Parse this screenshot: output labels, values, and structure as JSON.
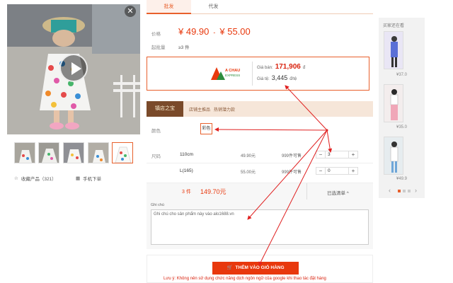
{
  "gallery": {
    "close_icon": "close-icon",
    "play_icon": "play-icon",
    "thumb_count": 5,
    "favorite_label": "收藏产品（321）",
    "mobile_label": "手机下单"
  },
  "tabs": [
    {
      "label": "批发",
      "active": true
    },
    {
      "label": "代发",
      "active": false
    }
  ],
  "price": {
    "label": "价格",
    "min": "¥ 49.90",
    "sep": "-",
    "max": "¥ 55.00",
    "moq_label": "起批量",
    "moq_value": "≥3 件"
  },
  "shipping": {
    "brand": "A CHAU",
    "brand_sub": "EXPRESS",
    "sell_label": "Giá bán:",
    "sell_value": "171,906",
    "sell_unit": "đ",
    "ship_label": "Giá tệ:",
    "ship_value": "3,445",
    "ship_unit": "đ/tệ"
  },
  "shop": {
    "badge": "镇店之宝",
    "link1": "店铺主推品",
    "link2": "热销潜力款"
  },
  "color": {
    "label": "颜色",
    "value": "彩色"
  },
  "sizes": {
    "label": "尺码",
    "rows": [
      {
        "size": "110cm",
        "price": "49.90元",
        "stock": "999件可售",
        "qty": "3"
      },
      {
        "size": "L(165)",
        "price": "55.00元",
        "stock": "999件可售",
        "qty": "0"
      }
    ]
  },
  "summary": {
    "count": "3 件",
    "total": "149.70元",
    "selected": "已选清单 ^"
  },
  "note": {
    "label": "Ghi chú",
    "placeholder": "Ghi chú cho sản phẩm này vào alo1688.vn"
  },
  "cart": {
    "button": "THÊM VÀO GIỎ HÀNG",
    "warning": "Lưu ý: Không nên sử dụng chức năng dịch ngôn ngữ của google khi thao tác đặt hàng"
  },
  "right": {
    "title": "买家还在看",
    "items": [
      {
        "price": "¥37.0"
      },
      {
        "price": "¥35.0"
      },
      {
        "price": "¥49.9"
      }
    ],
    "prev": "‹",
    "next": "›"
  },
  "colors": {
    "accent": "#e8602c",
    "price_red": "#e8380d",
    "annotation": "#e02020"
  }
}
